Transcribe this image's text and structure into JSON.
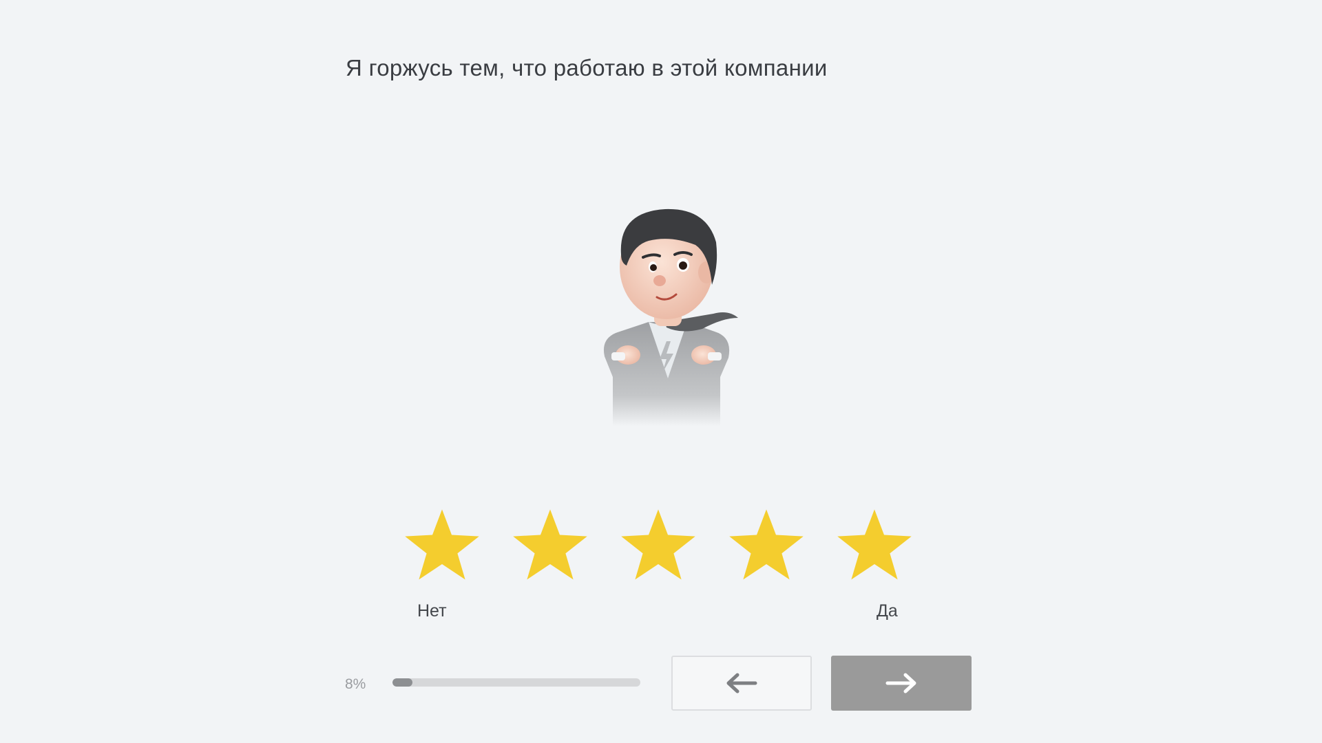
{
  "question": {
    "text": "Я горжусь тем, что работаю в этой компании"
  },
  "mascot": {
    "icon": "businessman-superhero-illustration"
  },
  "rating": {
    "max": 5,
    "value": 5,
    "star_color": "#f4cd2e",
    "min_label": "Нет",
    "max_label": "Да"
  },
  "progress": {
    "label": "8%",
    "percent": 8,
    "fill_color": "#8d8f92"
  },
  "navigation": {
    "back_icon": "arrow-left-icon",
    "next_icon": "arrow-right-icon",
    "next_color": "#9a9a9a"
  }
}
